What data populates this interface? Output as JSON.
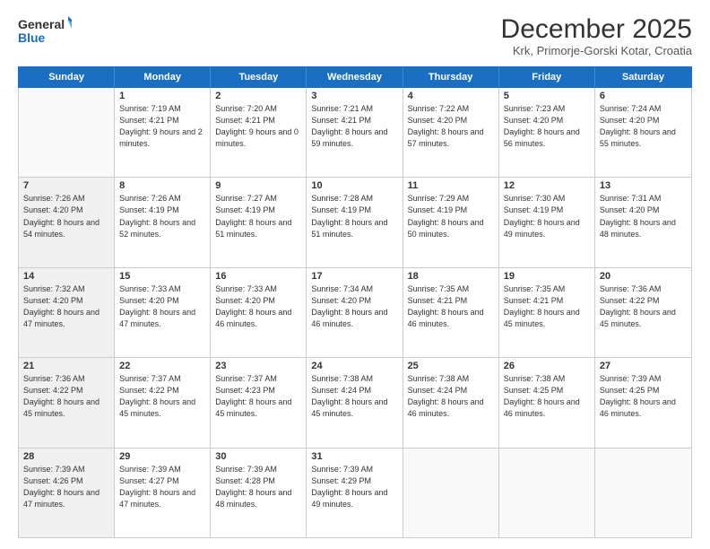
{
  "header": {
    "logo_line1": "General",
    "logo_line2": "Blue",
    "title": "December 2025",
    "subtitle": "Krk, Primorje-Gorski Kotar, Croatia"
  },
  "calendar": {
    "days_of_week": [
      "Sunday",
      "Monday",
      "Tuesday",
      "Wednesday",
      "Thursday",
      "Friday",
      "Saturday"
    ],
    "weeks": [
      [
        {
          "day": "",
          "shaded": true,
          "empty": true
        },
        {
          "day": "1",
          "shaded": false,
          "sunrise": "7:19 AM",
          "sunset": "4:21 PM",
          "daylight": "9 hours and 2 minutes."
        },
        {
          "day": "2",
          "shaded": false,
          "sunrise": "7:20 AM",
          "sunset": "4:21 PM",
          "daylight": "9 hours and 0 minutes."
        },
        {
          "day": "3",
          "shaded": false,
          "sunrise": "7:21 AM",
          "sunset": "4:21 PM",
          "daylight": "8 hours and 59 minutes."
        },
        {
          "day": "4",
          "shaded": false,
          "sunrise": "7:22 AM",
          "sunset": "4:20 PM",
          "daylight": "8 hours and 57 minutes."
        },
        {
          "day": "5",
          "shaded": false,
          "sunrise": "7:23 AM",
          "sunset": "4:20 PM",
          "daylight": "8 hours and 56 minutes."
        },
        {
          "day": "6",
          "shaded": false,
          "sunrise": "7:24 AM",
          "sunset": "4:20 PM",
          "daylight": "8 hours and 55 minutes."
        }
      ],
      [
        {
          "day": "7",
          "shaded": true,
          "sunrise": "7:26 AM",
          "sunset": "4:20 PM",
          "daylight": "8 hours and 54 minutes."
        },
        {
          "day": "8",
          "shaded": false,
          "sunrise": "7:26 AM",
          "sunset": "4:19 PM",
          "daylight": "8 hours and 52 minutes."
        },
        {
          "day": "9",
          "shaded": false,
          "sunrise": "7:27 AM",
          "sunset": "4:19 PM",
          "daylight": "8 hours and 51 minutes."
        },
        {
          "day": "10",
          "shaded": false,
          "sunrise": "7:28 AM",
          "sunset": "4:19 PM",
          "daylight": "8 hours and 51 minutes."
        },
        {
          "day": "11",
          "shaded": false,
          "sunrise": "7:29 AM",
          "sunset": "4:19 PM",
          "daylight": "8 hours and 50 minutes."
        },
        {
          "day": "12",
          "shaded": false,
          "sunrise": "7:30 AM",
          "sunset": "4:19 PM",
          "daylight": "8 hours and 49 minutes."
        },
        {
          "day": "13",
          "shaded": false,
          "sunrise": "7:31 AM",
          "sunset": "4:20 PM",
          "daylight": "8 hours and 48 minutes."
        }
      ],
      [
        {
          "day": "14",
          "shaded": true,
          "sunrise": "7:32 AM",
          "sunset": "4:20 PM",
          "daylight": "8 hours and 47 minutes."
        },
        {
          "day": "15",
          "shaded": false,
          "sunrise": "7:33 AM",
          "sunset": "4:20 PM",
          "daylight": "8 hours and 47 minutes."
        },
        {
          "day": "16",
          "shaded": false,
          "sunrise": "7:33 AM",
          "sunset": "4:20 PM",
          "daylight": "8 hours and 46 minutes."
        },
        {
          "day": "17",
          "shaded": false,
          "sunrise": "7:34 AM",
          "sunset": "4:20 PM",
          "daylight": "8 hours and 46 minutes."
        },
        {
          "day": "18",
          "shaded": false,
          "sunrise": "7:35 AM",
          "sunset": "4:21 PM",
          "daylight": "8 hours and 46 minutes."
        },
        {
          "day": "19",
          "shaded": false,
          "sunrise": "7:35 AM",
          "sunset": "4:21 PM",
          "daylight": "8 hours and 45 minutes."
        },
        {
          "day": "20",
          "shaded": false,
          "sunrise": "7:36 AM",
          "sunset": "4:22 PM",
          "daylight": "8 hours and 45 minutes."
        }
      ],
      [
        {
          "day": "21",
          "shaded": true,
          "sunrise": "7:36 AM",
          "sunset": "4:22 PM",
          "daylight": "8 hours and 45 minutes."
        },
        {
          "day": "22",
          "shaded": false,
          "sunrise": "7:37 AM",
          "sunset": "4:22 PM",
          "daylight": "8 hours and 45 minutes."
        },
        {
          "day": "23",
          "shaded": false,
          "sunrise": "7:37 AM",
          "sunset": "4:23 PM",
          "daylight": "8 hours and 45 minutes."
        },
        {
          "day": "24",
          "shaded": false,
          "sunrise": "7:38 AM",
          "sunset": "4:24 PM",
          "daylight": "8 hours and 45 minutes."
        },
        {
          "day": "25",
          "shaded": false,
          "sunrise": "7:38 AM",
          "sunset": "4:24 PM",
          "daylight": "8 hours and 46 minutes."
        },
        {
          "day": "26",
          "shaded": false,
          "sunrise": "7:38 AM",
          "sunset": "4:25 PM",
          "daylight": "8 hours and 46 minutes."
        },
        {
          "day": "27",
          "shaded": false,
          "sunrise": "7:39 AM",
          "sunset": "4:25 PM",
          "daylight": "8 hours and 46 minutes."
        }
      ],
      [
        {
          "day": "28",
          "shaded": true,
          "sunrise": "7:39 AM",
          "sunset": "4:26 PM",
          "daylight": "8 hours and 47 minutes."
        },
        {
          "day": "29",
          "shaded": false,
          "sunrise": "7:39 AM",
          "sunset": "4:27 PM",
          "daylight": "8 hours and 47 minutes."
        },
        {
          "day": "30",
          "shaded": false,
          "sunrise": "7:39 AM",
          "sunset": "4:28 PM",
          "daylight": "8 hours and 48 minutes."
        },
        {
          "day": "31",
          "shaded": false,
          "sunrise": "7:39 AM",
          "sunset": "4:29 PM",
          "daylight": "8 hours and 49 minutes."
        },
        {
          "day": "",
          "shaded": true,
          "empty": true
        },
        {
          "day": "",
          "shaded": true,
          "empty": true
        },
        {
          "day": "",
          "shaded": true,
          "empty": true
        }
      ]
    ]
  }
}
